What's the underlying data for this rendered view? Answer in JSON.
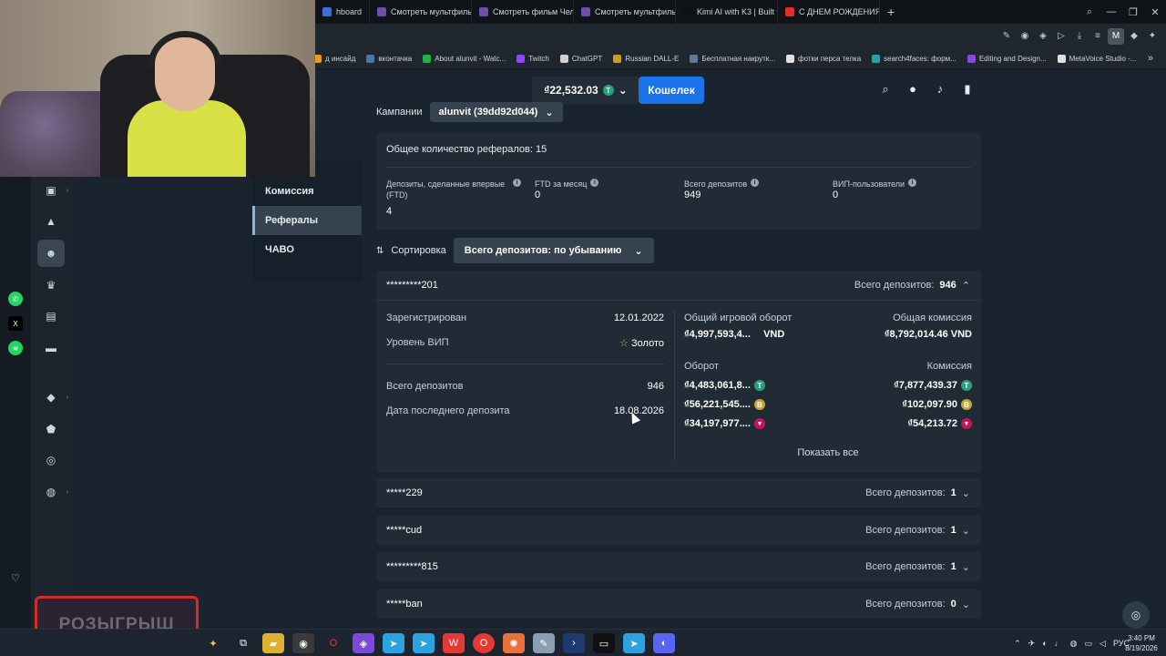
{
  "browser": {
    "tabs": [
      {
        "label": "hboard",
        "color": "#3a6fd8"
      },
      {
        "label": "Смотреть мультфильм Н",
        "color": "#6c4fa0"
      },
      {
        "label": "Смотреть фильм Челове",
        "color": "#6c4fa0"
      },
      {
        "label": "Смотреть мультфильм С",
        "color": "#6c4fa0"
      },
      {
        "label": "Kimi AI with K3 | Built for A",
        "color": "#111111"
      },
      {
        "label": "С ДНЕМ РОЖДЕНИЯ (alu",
        "color": "#e52b2b"
      }
    ],
    "profile_letter": "M",
    "bookmarks": [
      {
        "label": "д инсайд",
        "color": "#e0a020"
      },
      {
        "label": "вконтачка",
        "color": "#4c75a3"
      },
      {
        "label": "About alunvit - Watc...",
        "color": "#27b045"
      },
      {
        "label": "Twitch",
        "color": "#9147ff"
      },
      {
        "label": "ChatGPT",
        "color": "#d0d0d0"
      },
      {
        "label": "Russian DALL-E",
        "color": "#c8a028"
      },
      {
        "label": "Бесплатная накрутк...",
        "color": "#5e7a9a"
      },
      {
        "label": "фотки перса телка",
        "color": "#e0e0e0"
      },
      {
        "label": "search4faces: форм...",
        "color": "#28a0a8"
      },
      {
        "label": "Editing and Design...",
        "color": "#8a4ad8"
      },
      {
        "label": "MetaVoice Studio -...",
        "color": "#e0e0e0"
      }
    ]
  },
  "header": {
    "balance": "₫22,532.03",
    "wallet_label": "Кошелек"
  },
  "menu": {
    "items": [
      {
        "label": "Кампании",
        "active": false
      },
      {
        "label": "Комиссия",
        "active": false
      },
      {
        "label": "Рефералы",
        "active": true
      },
      {
        "label": "ЧАВО",
        "active": false
      }
    ]
  },
  "campaign": {
    "label": "Кампании",
    "value": "alunvit (39dd92d044)"
  },
  "summary": {
    "total_referrals": "Общее количество рефералов: 15",
    "stats": [
      {
        "label": "Депозиты, сделанные впервые (FTD)",
        "value": "4"
      },
      {
        "label": "FTD за месяц",
        "value": "0"
      },
      {
        "label": "Всего депозитов",
        "value": "949"
      },
      {
        "label": "ВИП-пользователи",
        "value": "0"
      }
    ]
  },
  "sort": {
    "label": "Сортировка",
    "value": "Всего депозитов: по убыванию"
  },
  "deposits_label": "Всего депозитов:",
  "expanded_referral": {
    "id": "*********201",
    "total_deposits": "946",
    "registered_label": "Зарегистрирован",
    "registered_value": "12.01.2022",
    "vip_label": "Уровень ВИП",
    "vip_value": "Золото",
    "deposits_label": "Всего депозитов",
    "deposits_value": "946",
    "last_deposit_label": "Дата последнего депозита",
    "last_deposit_value": "18.08.2026",
    "turnover_total_label": "Общий игровой оборот",
    "turnover_total_value": "₫4,997,593,4...",
    "turnover_currency": "VND",
    "commission_total_label": "Общая комиссия",
    "commission_total_value": "₫8,792,014.46 VND",
    "turnover_label": "Оборот",
    "commission_label": "Комиссия",
    "rows": [
      {
        "turnover": "₫4,483,061,8...",
        "commission": "₫7,877,439.37",
        "coin": "T"
      },
      {
        "turnover": "₫56,221,545....",
        "commission": "₫102,097.90",
        "coin": "B"
      },
      {
        "turnover": "₫34,197,977....",
        "commission": "₫54,213.72",
        "coin": "R"
      }
    ],
    "show_all_label": "Показать все"
  },
  "collapsed_referrals": [
    {
      "id": "*****229",
      "deposits": "1"
    },
    {
      "id": "*****cud",
      "deposits": "1"
    },
    {
      "id": "*********815",
      "deposits": "1"
    },
    {
      "id": "*****ban",
      "deposits": "0"
    }
  ],
  "promo_label": "РОЗЫГРЫШ",
  "taskbar": {
    "lang": "РУС",
    "time": "3:40 PM",
    "date": "8/19/2026"
  }
}
